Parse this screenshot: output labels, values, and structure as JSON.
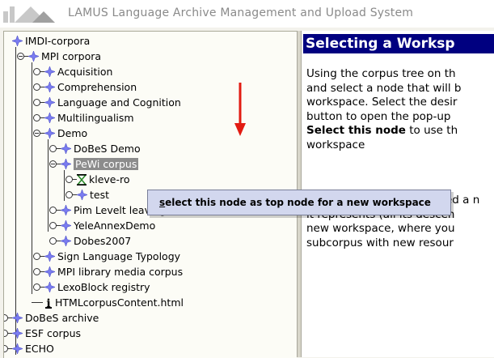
{
  "app": {
    "title": "LAMUS  Language Archive Management and Upload System"
  },
  "tree": {
    "nodes": [
      {
        "label": "IMDI-corpora",
        "icon": "corpus-star-icon"
      },
      {
        "label": "MPI corpora",
        "icon": "corpus-star-icon"
      },
      {
        "label": "Acquisition",
        "icon": "corpus-star-icon"
      },
      {
        "label": "Comprehension",
        "icon": "corpus-star-icon"
      },
      {
        "label": "Language and Cognition",
        "icon": "corpus-star-icon"
      },
      {
        "label": "Multilingualism",
        "icon": "corpus-star-icon"
      },
      {
        "label": "Demo",
        "icon": "corpus-star-icon"
      },
      {
        "label": "DoBeS Demo",
        "icon": "corpus-star-icon"
      },
      {
        "label": "PeWi corpus",
        "icon": "corpus-star-icon",
        "selected": true
      },
      {
        "label": "kleve-ro",
        "icon": "session-hourglass-icon"
      },
      {
        "label": "test",
        "icon": "corpus-star-icon"
      },
      {
        "label": "Pim Levelt leaving MPI",
        "icon": "corpus-star-icon"
      },
      {
        "label": "YeleAnnexDemo",
        "icon": "corpus-star-icon"
      },
      {
        "label": "Dobes2007",
        "icon": "corpus-star-icon"
      },
      {
        "label": "Sign Language Typology",
        "icon": "corpus-star-icon"
      },
      {
        "label": "MPI library media corpus",
        "icon": "corpus-star-icon"
      },
      {
        "label": "LexoBlock registry",
        "icon": "corpus-star-icon"
      },
      {
        "label": "HTMLcorpusContent.html",
        "icon": "info-document-icon"
      },
      {
        "label": "DoBeS archive",
        "icon": "corpus-star-icon"
      },
      {
        "label": "ESF corpus",
        "icon": "corpus-star-icon"
      },
      {
        "label": "ECHO",
        "icon": "corpus-star-icon"
      }
    ]
  },
  "context_menu": {
    "item_label": "select this node as top node for a new workspace"
  },
  "help": {
    "title": "Selecting a Worksp",
    "para1": [
      "Using the corpus tree on th",
      "and select a node that will b",
      "workspace. Select the desir",
      "button to open the pop-up"
    ],
    "para1_bold": "Select this node",
    "para1_bold_rest": " to use th",
    "para1_last": "workspace",
    "para2_first": "ed a n",
    "para2": [
      "it represents (all its descen",
      "new workspace, where you",
      "subcorpus with new resour"
    ]
  },
  "colors": {
    "title_bar": "#000080",
    "selection": "#8c8c8c",
    "context_menu_bg": "#d2d7ee",
    "arrow": "#e21b12",
    "corpus_icon": "#7a7cf0",
    "session_icon": "#2b8a2b"
  }
}
